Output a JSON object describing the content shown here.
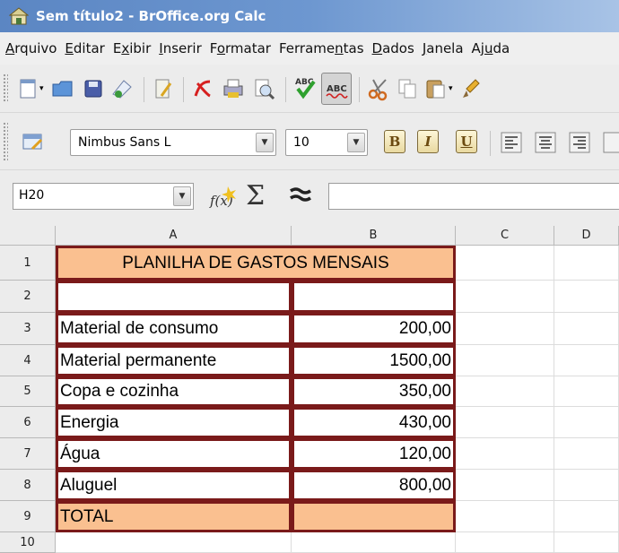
{
  "window": {
    "title": "Sem título2 - BrOffice.org Calc"
  },
  "menu": [
    {
      "label": "Arquivo",
      "accel": 0
    },
    {
      "label": "Editar",
      "accel": 0
    },
    {
      "label": "Exibir",
      "accel": 1
    },
    {
      "label": "Inserir",
      "accel": 0
    },
    {
      "label": "Formatar",
      "accel": 1
    },
    {
      "label": "Ferramentas",
      "accel": 7
    },
    {
      "label": "Dados",
      "accel": 0
    },
    {
      "label": "Janela",
      "accel": 0
    },
    {
      "label": "Ajuda",
      "accel": 2
    }
  ],
  "toolbar": {
    "font_name": "Nimbus Sans L",
    "font_size": "10",
    "bold": "B",
    "italic": "I",
    "underline": "U"
  },
  "formula_bar": {
    "cell_ref": "H20",
    "content": ""
  },
  "sheet": {
    "columns": [
      "A",
      "B",
      "C",
      "D"
    ],
    "rows": [
      "1",
      "2",
      "3",
      "4",
      "5",
      "6",
      "7",
      "8",
      "9",
      "10"
    ],
    "title": "PLANILHA DE GASTOS MENSAIS",
    "items": [
      {
        "label": "Material de consumo",
        "value": "200,00"
      },
      {
        "label": "Material permanente",
        "value": "1500,00"
      },
      {
        "label": "Copa e cozinha",
        "value": "350,00"
      },
      {
        "label": "Energia",
        "value": "430,00"
      },
      {
        "label": "Água",
        "value": "120,00"
      },
      {
        "label": "Aluguel",
        "value": "800,00"
      }
    ],
    "total_label": "TOTAL",
    "total_value": "",
    "highlight_color": "#fac090",
    "border_color": "#7a1a1a"
  }
}
